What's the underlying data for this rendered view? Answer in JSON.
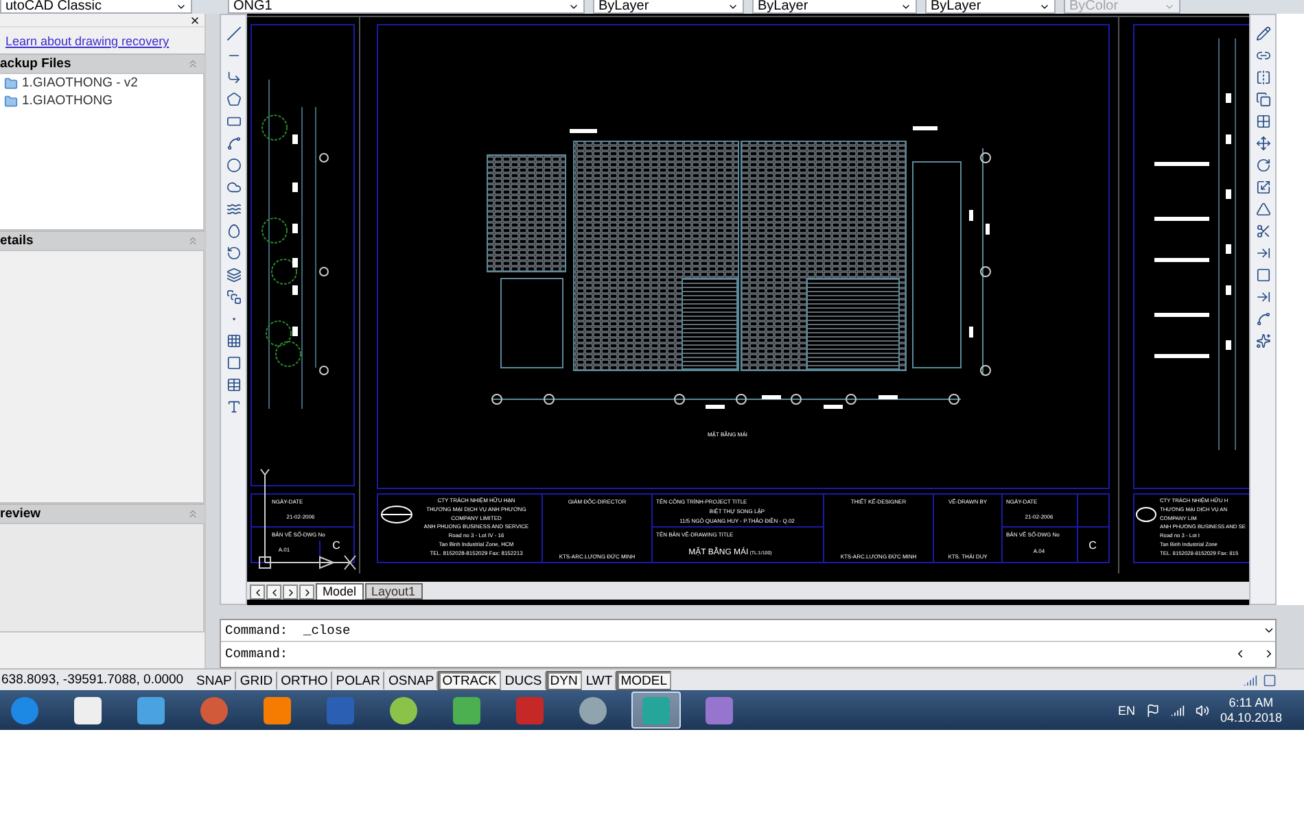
{
  "toolbar": {
    "workspace": "utoCAD Classic",
    "layer": "ONG1",
    "color_control": "ByLayer",
    "linetype": "ByLayer",
    "lineweight": "ByLayer",
    "plot_style": {
      "label": "ByColor",
      "disabled": true
    }
  },
  "recovery_panel": {
    "link": "Learn about drawing recovery",
    "sections": [
      {
        "title": "ackup Files",
        "items": [
          "1.GIAOTHONG - v2",
          "1.GIAOTHONG"
        ]
      },
      {
        "title": "etails"
      },
      {
        "title": "review"
      }
    ]
  },
  "drawing": {
    "plan_label": "MẶT BẰNG MÁI",
    "main_title_block": {
      "company": [
        "CTY TRÁCH NHIỆM HỮU HẠN",
        "THƯƠNG MẠI DỊCH VỤ ANH PHƯƠNG",
        "COMPANY LIMITED",
        "ANH PHUONG BUSINESS AND SERVICE",
        "Road no 3 - Lot IV - 16",
        "Tan Binh Industrial Zone, HCM",
        "TEL. 8152028-8152029 Fax: 8152213"
      ],
      "director_label": "GIÁM ĐỐC-DIRECTOR",
      "director": "KTS-ARC.LƯƠNG ĐỨC MINH",
      "project_label": "TÊN CÔNG TRÌNH-PROJECT TITLE",
      "project": [
        "BIỆT THỰ SONG LẬP",
        "11/5 NGÔ QUANG HUY - P.THẢO ĐIỀN - Q.02"
      ],
      "drawing_title_label": "TÊN BẢN VẼ-DRAWING TITLE",
      "drawing_title": "MẶT BẰNG MÁI",
      "scale": "(TL:1/100)",
      "designer_label": "THIẾT KẾ-DESIGNER",
      "designer": "KTS-ARC.LƯƠNG ĐỨC MINH",
      "drawn_by_label": "VẼ-DRAWN BY",
      "drawn_by": "KTS. THÁI DUY",
      "date_label": "NGÀY-DATE",
      "date": "21-02-2006",
      "sheet_label": "BẢN VẼ SỐ-DWG No",
      "sheet": "A.04",
      "revision": "C"
    },
    "left_title_block": {
      "date_label": "NGÀY-DATE",
      "date": "21-02-2006",
      "sheet_label": "BẢN VẼ SỐ-DWG No",
      "sheet": "A.01",
      "revision": "C"
    },
    "right_title_block": {
      "company": [
        "CTY TRÁCH NHIỆM HỮU H",
        "THƯƠNG MẠI DỊCH VỤ AN",
        "COMPANY LIM",
        "ANH PHUONG BUSINESS AND SE",
        "Road no 3 - Lot I",
        "Tan Binh Industrial Zone",
        "TEL. 8152028-8152029 Fax: 815"
      ]
    }
  },
  "layout_tabs": [
    {
      "label": "Model",
      "selected": true
    },
    {
      "label": "Layout1",
      "selected": false
    }
  ],
  "command_history": [
    "Command:  _close"
  ],
  "command_prompt": "Command:",
  "status_bar": {
    "coordinates": "638.8093, -39591.7088, 0.0000",
    "toggles": [
      {
        "label": "SNAP",
        "on": false
      },
      {
        "label": "GRID",
        "on": false
      },
      {
        "label": "ORTHO",
        "on": false
      },
      {
        "label": "POLAR",
        "on": false
      },
      {
        "label": "OSNAP",
        "on": false
      },
      {
        "label": "OTRACK",
        "on": true
      },
      {
        "label": "DUCS",
        "on": false
      },
      {
        "label": "DYN",
        "on": true
      },
      {
        "label": "LWT",
        "on": false
      },
      {
        "label": "MODEL",
        "on": true
      }
    ]
  },
  "taskbar": {
    "language": "EN",
    "time": "6:11 AM",
    "date": "04.10.2018"
  }
}
